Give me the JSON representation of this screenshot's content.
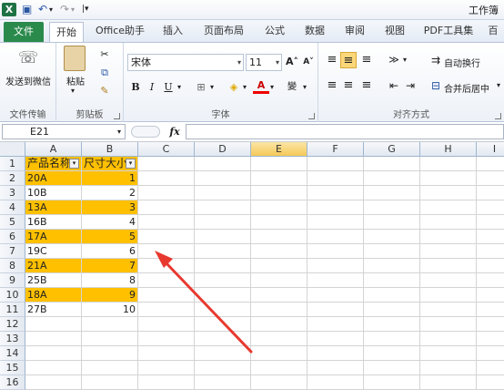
{
  "window": {
    "title": "工作簿"
  },
  "tabs": [
    "文件",
    "开始",
    "Office助手",
    "插入",
    "页面布局",
    "公式",
    "数据",
    "审阅",
    "视图",
    "PDF工具集",
    "百"
  ],
  "ribbon": {
    "send_wechat": "发送到微信",
    "paste": "粘贴",
    "font_name": "宋体",
    "font_size": "11",
    "bold": "B",
    "italic": "I",
    "underline": "U",
    "wrap_text": "自动换行",
    "merge_center": "合并后居中",
    "groups": {
      "file_transfer": "文件传输",
      "clipboard": "剪贴板",
      "font": "字体",
      "alignment": "对齐方式"
    }
  },
  "formula_bar": {
    "name_box": "E21",
    "fx": "fx",
    "formula": ""
  },
  "grid": {
    "columns": [
      "A",
      "B",
      "C",
      "D",
      "E",
      "F",
      "G",
      "H",
      "I"
    ],
    "selected_column": "E",
    "rows": [
      "1",
      "2",
      "3",
      "4",
      "5",
      "6",
      "7",
      "8",
      "9",
      "10",
      "11",
      "12",
      "13",
      "14",
      "15",
      "16"
    ],
    "header": {
      "a": "产品名称",
      "b": "尺寸大小"
    },
    "data": [
      {
        "a": "20A",
        "b": "1",
        "highlight": true
      },
      {
        "a": "10B",
        "b": "2",
        "highlight": false
      },
      {
        "a": "13A",
        "b": "3",
        "highlight": true
      },
      {
        "a": "16B",
        "b": "4",
        "highlight": false
      },
      {
        "a": "17A",
        "b": "5",
        "highlight": true
      },
      {
        "a": "19C",
        "b": "6",
        "highlight": false
      },
      {
        "a": "21A",
        "b": "7",
        "highlight": true
      },
      {
        "a": "25B",
        "b": "8",
        "highlight": false
      },
      {
        "a": "18A",
        "b": "9",
        "highlight": true
      },
      {
        "a": "27B",
        "b": "10",
        "highlight": false
      }
    ]
  },
  "colors": {
    "highlight": "#ffc000",
    "arrow": "#e8392f",
    "excel_green": "#1f7244"
  }
}
